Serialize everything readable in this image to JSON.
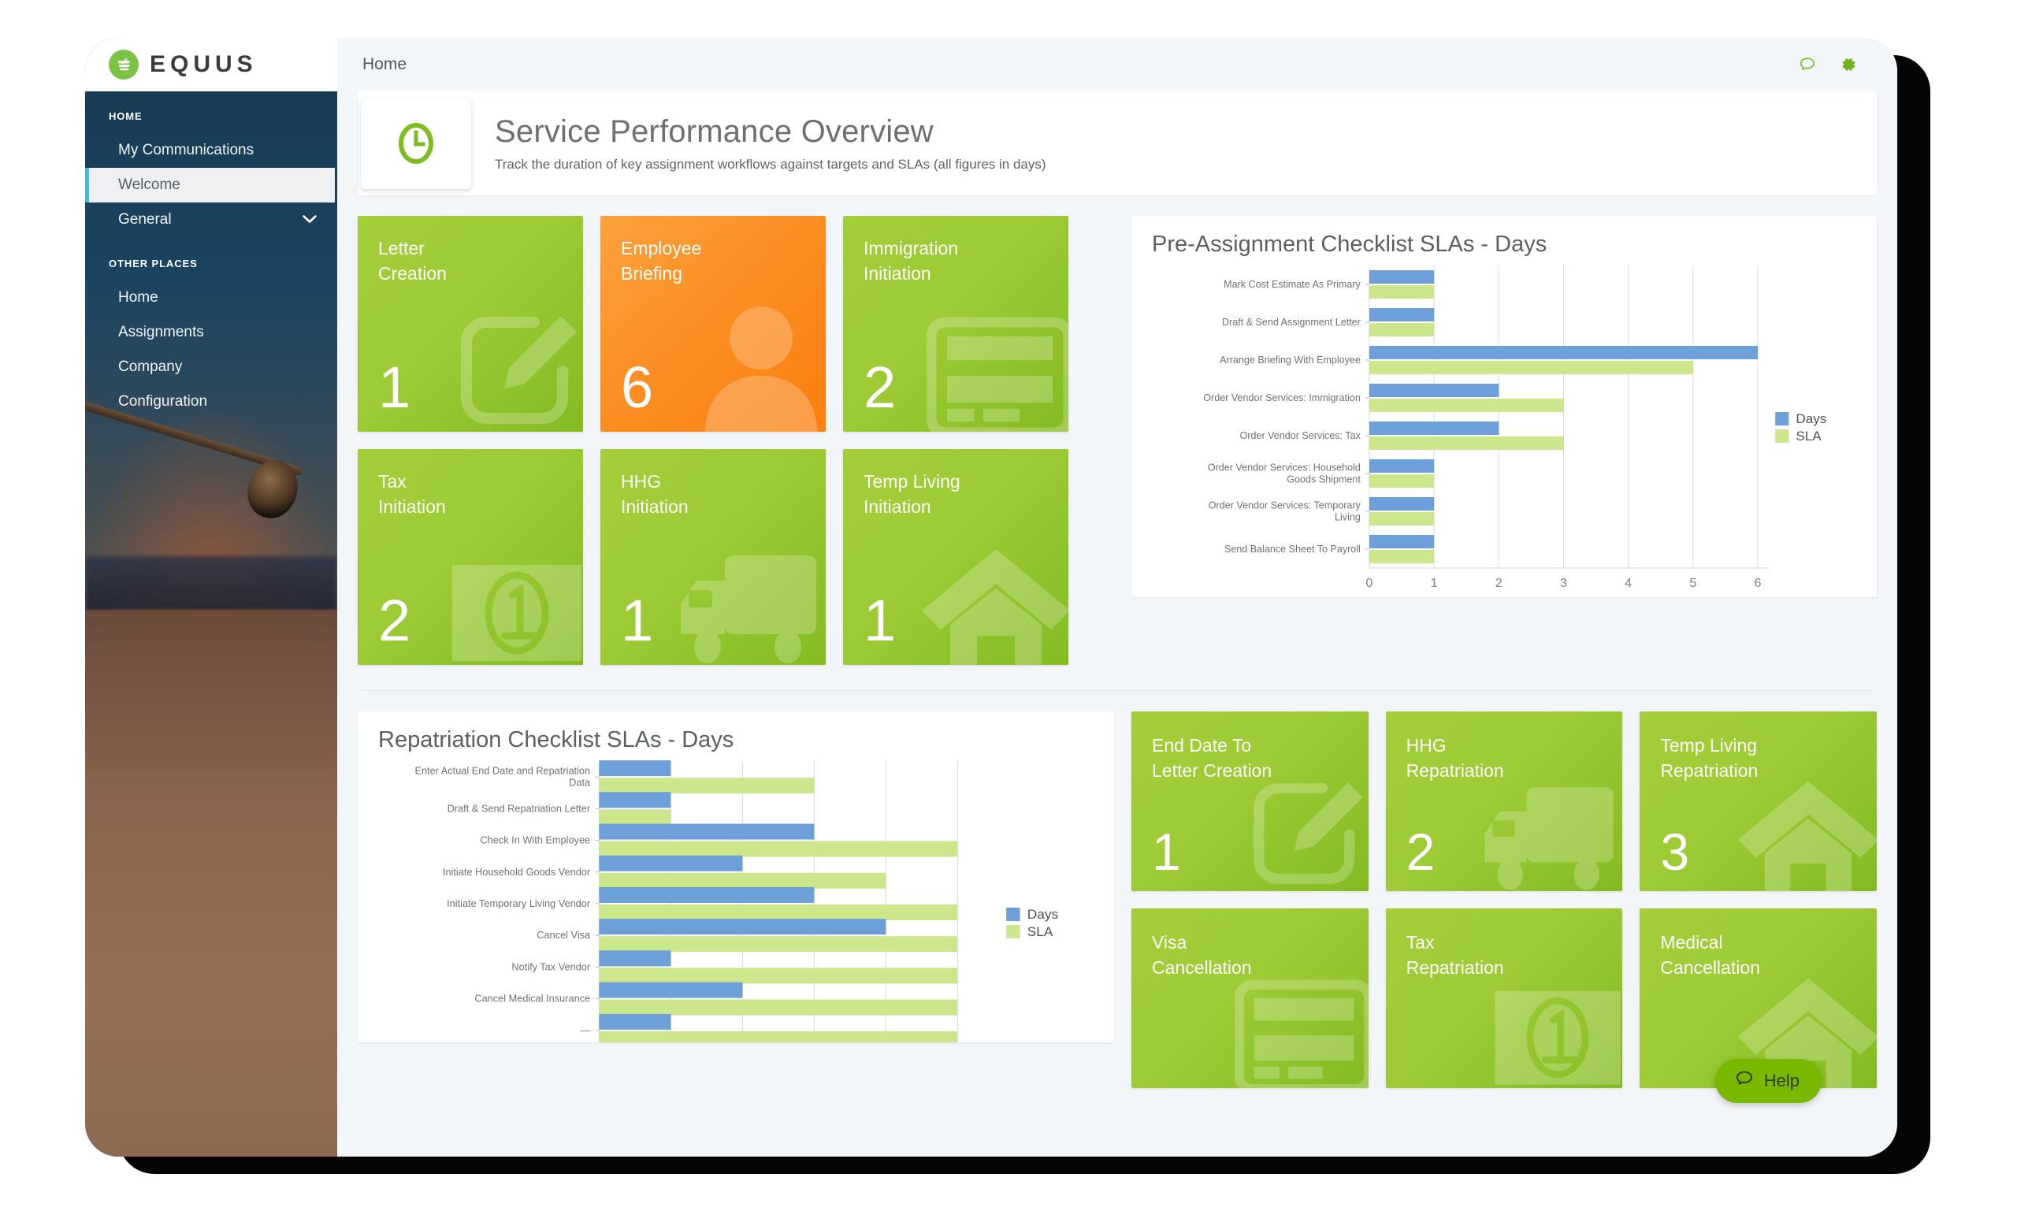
{
  "brand": {
    "name": "EQUUS",
    "logo_icon": "equus-logo-icon",
    "accent": "#7dc242"
  },
  "sidebar": {
    "sections": [
      {
        "label": "HOME",
        "items": [
          {
            "label": "My Communications",
            "active": false
          },
          {
            "label": "Welcome",
            "active": true
          },
          {
            "label": "General",
            "active": false,
            "caret": "⌄"
          }
        ]
      },
      {
        "label": "OTHER PLACES",
        "items": [
          {
            "label": "Home",
            "active": false
          },
          {
            "label": "Assignments",
            "active": false
          },
          {
            "label": "Company",
            "active": false
          },
          {
            "label": "Configuration",
            "active": false
          }
        ]
      }
    ]
  },
  "topbar": {
    "breadcrumb": "Home",
    "chat_icon": "chat-bubble-icon",
    "settings_icon": "gear-icon"
  },
  "page": {
    "icon": "clock-icon",
    "title": "Service Performance Overview",
    "subtitle": "Track the duration of key assignment workflows against targets and SLAs (all figures in days)"
  },
  "tiles_preassignment": [
    {
      "label": "Letter\nCreation",
      "value": "1",
      "color": "green",
      "art": "pencil-square-icon"
    },
    {
      "label": "Employee\nBriefing",
      "value": "6",
      "color": "orange",
      "art": "person-icon"
    },
    {
      "label": "Immigration\nInitiation",
      "value": "2",
      "color": "green",
      "art": "id-card-icon"
    },
    {
      "label": "Tax\nInitiation",
      "value": "2",
      "color": "green",
      "art": "banknote-icon"
    },
    {
      "label": "HHG\nInitiation",
      "value": "1",
      "color": "green",
      "art": "truck-icon"
    },
    {
      "label": "Temp Living\nInitiation",
      "value": "1",
      "color": "green",
      "art": "house-icon"
    }
  ],
  "tiles_repatriation": [
    {
      "label": "End Date To\nLetter Creation",
      "value": "1",
      "color": "green",
      "art": "pencil-square-icon"
    },
    {
      "label": "HHG\nRepatriation",
      "value": "2",
      "color": "green",
      "art": "truck-icon"
    },
    {
      "label": "Temp Living\nRepatriation",
      "value": "3",
      "color": "green",
      "art": "house-icon"
    },
    {
      "label": "Visa\nCancellation",
      "value": "",
      "color": "green",
      "art": "id-card-icon"
    },
    {
      "label": "Tax\nRepatriation",
      "value": "",
      "color": "green",
      "art": "banknote-icon"
    },
    {
      "label": "Medical\nCancellation",
      "value": "",
      "color": "green",
      "art": "house-icon"
    }
  ],
  "help": {
    "label": "Help",
    "icon": "chat-bubble-icon",
    "color": "#7ab800"
  },
  "colors": {
    "days": "#6d9fd8",
    "sla": "#cbe68b",
    "tile_green": "#9ccb35",
    "tile_orange": "#fb8e22"
  },
  "chart_data": [
    {
      "id": "pre-assignment",
      "type": "bar",
      "orientation": "horizontal",
      "title": "Pre-Assignment Checklist SLAs - Days",
      "xlabel": "",
      "ylabel": "",
      "xlim": [
        0,
        6
      ],
      "xticks": [
        0,
        1,
        2,
        3,
        4,
        5,
        6
      ],
      "grid": true,
      "legend": "right",
      "categories": [
        "Mark Cost Estimate As Primary",
        "Draft & Send Assignment Letter",
        "Arrange Briefing With Employee",
        "Order Vendor Services: Immigration",
        "Order Vendor Services: Tax",
        "Order Vendor Services: Household Goods Shipment",
        "Order Vendor Services: Temporary Living",
        "Send Balance Sheet To Payroll"
      ],
      "series": [
        {
          "name": "Days",
          "color": "#6d9fd8",
          "values": [
            1,
            1,
            6,
            2,
            2,
            1,
            1,
            1
          ]
        },
        {
          "name": "SLA",
          "color": "#cbe68b",
          "values": [
            1,
            1,
            5,
            3,
            3,
            1,
            1,
            1
          ]
        }
      ]
    },
    {
      "id": "repatriation",
      "type": "bar",
      "orientation": "horizontal",
      "title": "Repatriation Checklist SLAs - Days",
      "xlabel": "",
      "ylabel": "",
      "xlim": [
        0,
        5.5
      ],
      "xticks": [
        0,
        1,
        2,
        3,
        4,
        5
      ],
      "grid": true,
      "legend": "right",
      "categories": [
        "Enter Actual End Date and Repatriation Data",
        "Draft & Send Repatriation Letter",
        "Check In With Employee",
        "Initiate Household Goods Vendor",
        "Initiate Temporary Living Vendor",
        "Cancel Visa",
        "Notify Tax Vendor",
        "Cancel Medical Insurance",
        "—"
      ],
      "series": [
        {
          "name": "Days",
          "color": "#6d9fd8",
          "values": [
            1,
            1,
            3,
            2,
            3,
            4,
            1,
            2,
            1
          ]
        },
        {
          "name": "SLA",
          "color": "#cbe68b",
          "values": [
            3,
            1,
            5,
            4,
            5,
            5,
            5,
            5,
            5
          ]
        }
      ]
    }
  ]
}
